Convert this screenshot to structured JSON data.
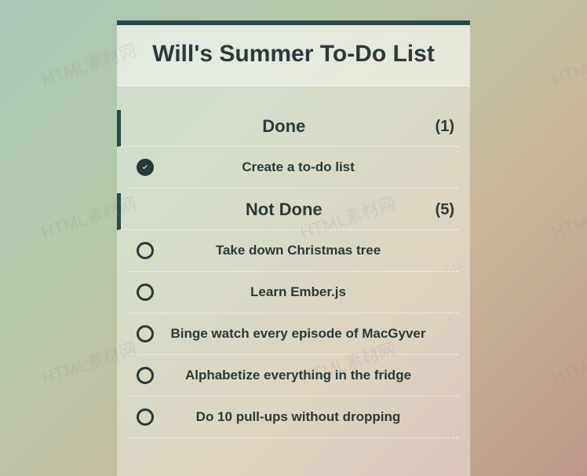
{
  "title": "Will's Summer To-Do List",
  "sections": {
    "done": {
      "label": "Done",
      "count": "(1)",
      "items": [
        {
          "label": "Create a to-do list"
        }
      ]
    },
    "notdone": {
      "label": "Not Done",
      "count": "(5)",
      "items": [
        {
          "label": "Take down Christmas tree"
        },
        {
          "label": "Learn Ember.js"
        },
        {
          "label": "Binge watch every episode of MacGyver"
        },
        {
          "label": "Alphabetize everything in the fridge"
        },
        {
          "label": "Do 10 pull-ups without dropping"
        }
      ]
    }
  },
  "watermark": "HTML素材网"
}
